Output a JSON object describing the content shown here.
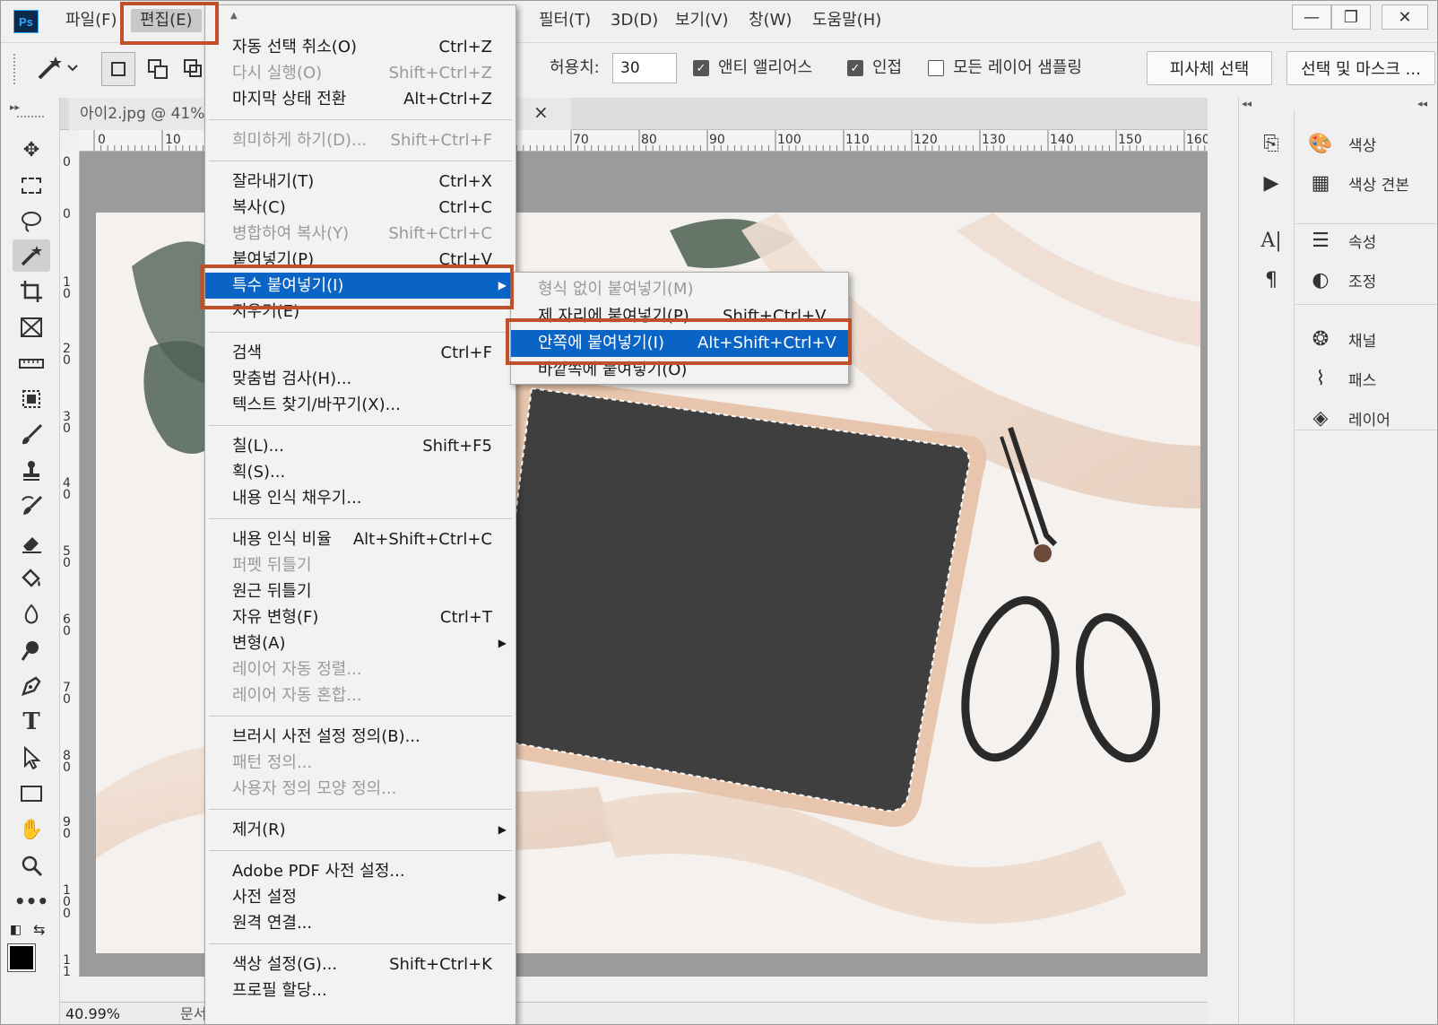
{
  "app": {
    "logo": "Ps"
  },
  "menubar": {
    "file": "파일(F)",
    "edit": "편집(E)",
    "filter": "필터(T)",
    "threed": "3D(D)",
    "view": "보기(V)",
    "window": "창(W)",
    "help": "도움말(H)"
  },
  "window_controls": {
    "minimize": "—",
    "restore": "❐",
    "close": "✕"
  },
  "options": {
    "tolerance_label": "허용치:",
    "tolerance_value": "30",
    "anti_alias_label": "앤티 앨리어스",
    "contiguous_label": "인접",
    "sample_all_label": "모든 레이어 샘플링",
    "subject_btn": "피사체 선택",
    "select_mask_btn": "선택 및 마스크 ..."
  },
  "document": {
    "tab_title": "아이2.jpg @ 41%",
    "tab_close": "×",
    "zoom": "40.99%",
    "status_text": "문서"
  },
  "ruler": {
    "h_labels": [
      "0",
      "10",
      "70",
      "80",
      "90",
      "100",
      "110",
      "120",
      "130",
      "140",
      "150",
      "160"
    ],
    "v_labels": [
      "0",
      "0",
      "1 0",
      "2 0",
      "3 0",
      "4 0",
      "5 0",
      "6 0",
      "7 0",
      "8 0",
      "9 0",
      "1 0 0",
      "1 1 0"
    ]
  },
  "edit_menu": {
    "items": [
      {
        "label": "자동 선택 취소(O)",
        "shortcut": "Ctrl+Z",
        "disabled": false
      },
      {
        "label": "다시 실행(O)",
        "shortcut": "Shift+Ctrl+Z",
        "disabled": true
      },
      {
        "label": "마지막 상태 전환",
        "shortcut": "Alt+Ctrl+Z",
        "disabled": false
      },
      {
        "label": "희미하게 하기(D)...",
        "shortcut": "Shift+Ctrl+F",
        "disabled": true
      },
      {
        "label": "잘라내기(T)",
        "shortcut": "Ctrl+X",
        "disabled": false
      },
      {
        "label": "복사(C)",
        "shortcut": "Ctrl+C",
        "disabled": false
      },
      {
        "label": "병합하여 복사(Y)",
        "shortcut": "Shift+Ctrl+C",
        "disabled": true
      },
      {
        "label": "붙여넣기(P)",
        "shortcut": "Ctrl+V",
        "disabled": false
      },
      {
        "label": "특수 붙여넣기(I)",
        "shortcut": "",
        "disabled": false
      },
      {
        "label": "지우기(E)",
        "shortcut": "",
        "disabled": false
      },
      {
        "label": "검색",
        "shortcut": "Ctrl+F",
        "disabled": false
      },
      {
        "label": "맞춤법 검사(H)...",
        "shortcut": "",
        "disabled": false
      },
      {
        "label": "텍스트 찾기/바꾸기(X)...",
        "shortcut": "",
        "disabled": false
      },
      {
        "label": "칠(L)...",
        "shortcut": "Shift+F5",
        "disabled": false
      },
      {
        "label": "획(S)...",
        "shortcut": "",
        "disabled": false
      },
      {
        "label": "내용 인식 채우기...",
        "shortcut": "",
        "disabled": false
      },
      {
        "label": "내용 인식 비율",
        "shortcut": "Alt+Shift+Ctrl+C",
        "disabled": false
      },
      {
        "label": "퍼펫 뒤틀기",
        "shortcut": "",
        "disabled": true
      },
      {
        "label": "원근 뒤틀기",
        "shortcut": "",
        "disabled": false
      },
      {
        "label": "자유 변형(F)",
        "shortcut": "Ctrl+T",
        "disabled": false
      },
      {
        "label": "변형(A)",
        "shortcut": "",
        "disabled": false
      },
      {
        "label": "레이어 자동 정렬...",
        "shortcut": "",
        "disabled": true
      },
      {
        "label": "레이어 자동 혼합...",
        "shortcut": "",
        "disabled": true
      },
      {
        "label": "브러시 사전 설정 정의(B)...",
        "shortcut": "",
        "disabled": false
      },
      {
        "label": "패턴 정의...",
        "shortcut": "",
        "disabled": true
      },
      {
        "label": "사용자 정의 모양 정의...",
        "shortcut": "",
        "disabled": true
      },
      {
        "label": "제거(R)",
        "shortcut": "",
        "disabled": false
      },
      {
        "label": "Adobe PDF 사전 설정...",
        "shortcut": "",
        "disabled": false
      },
      {
        "label": "사전 설정",
        "shortcut": "",
        "disabled": false
      },
      {
        "label": "원격 연결...",
        "shortcut": "",
        "disabled": false
      },
      {
        "label": "색상 설정(G)...",
        "shortcut": "Shift+Ctrl+K",
        "disabled": false
      },
      {
        "label": "프로필 할당...",
        "shortcut": "",
        "disabled": false
      }
    ]
  },
  "paste_special_menu": {
    "items": [
      {
        "label": "형식 없이 붙여넣기(M)",
        "shortcut": "",
        "disabled": true
      },
      {
        "label": "제 자리에 붙여넣기(P)",
        "shortcut": "Shift+Ctrl+V",
        "disabled": false
      },
      {
        "label": "안쪽에 붙여넣기(I)",
        "shortcut": "Alt+Shift+Ctrl+V",
        "disabled": false
      },
      {
        "label": "바깥쪽에 붙여넣기(O)",
        "shortcut": "",
        "disabled": false
      }
    ]
  },
  "panels": {
    "color": "색상",
    "swatches": "색상 견본",
    "properties": "속성",
    "adjustments": "조정",
    "channels": "채널",
    "paths": "패스",
    "layers": "레이어"
  },
  "colors": {
    "highlight": "#0a64c6",
    "callout": "#c0502a",
    "canvas_bg": "#9b9b9b"
  }
}
